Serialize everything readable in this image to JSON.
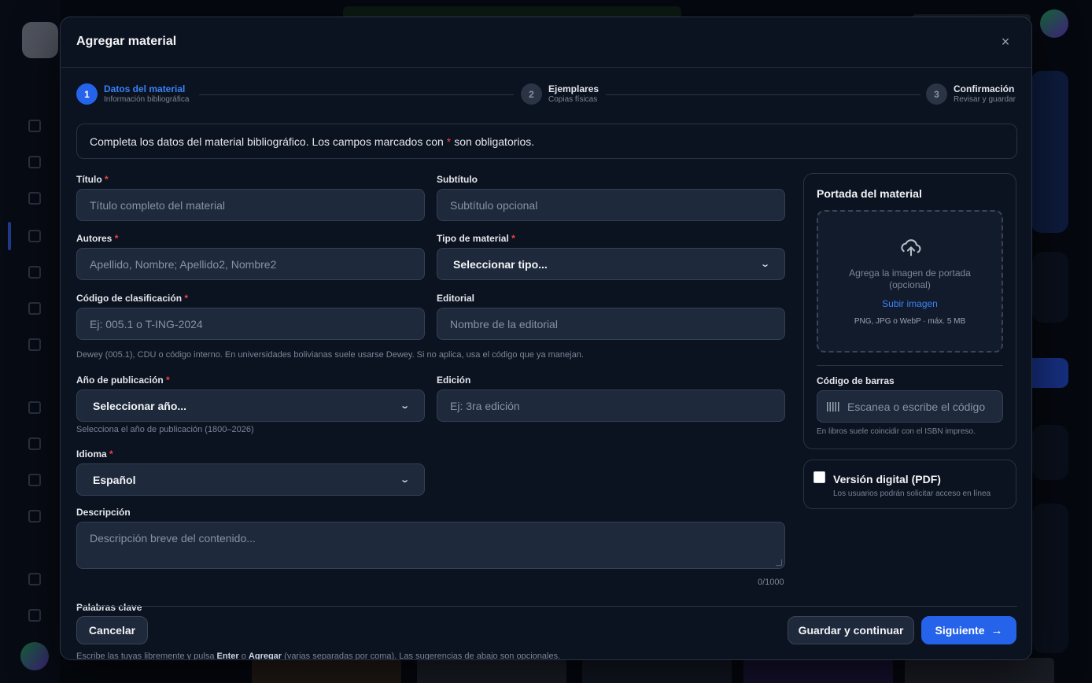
{
  "modal": {
    "title": "Agregar material",
    "close_icon": "×"
  },
  "stepper": {
    "steps": [
      {
        "number": "1",
        "label": "Datos del material",
        "sub": "Información bibliográfica",
        "state": "active"
      },
      {
        "number": "2",
        "label": "Ejemplares",
        "sub": "Copias físicas",
        "state": "idle"
      },
      {
        "number": "3",
        "label": "Confirmación",
        "sub": "Revisar y guardar",
        "state": "idle"
      }
    ]
  },
  "info": {
    "before": "Completa los datos del material bibliográfico. Los campos marcados con",
    "star": "*",
    "after": "son obligatorios."
  },
  "form": {
    "titulo": {
      "label": "Título",
      "required": "*",
      "placeholder": "Título completo del material"
    },
    "subtitulo": {
      "label": "Subtítulo",
      "placeholder": "Subtítulo opcional"
    },
    "autores": {
      "label": "Autores",
      "required": "*",
      "placeholder": "Apellido, Nombre; Apellido2, Nombre2"
    },
    "tipo": {
      "label": "Tipo de material",
      "required": "*",
      "value": "Seleccionar tipo..."
    },
    "codigo": {
      "label": "Código de clasificación",
      "required": "*",
      "placeholder": "Ej: 005.1 o T-ING-2024",
      "hint": "Dewey (005.1), CDU o código interno. En universidades bolivianas suele usarse Dewey. Si no aplica, usa el código que ya manejan."
    },
    "editorial": {
      "label": "Editorial",
      "placeholder": "Nombre de la editorial"
    },
    "anio": {
      "label": "Año de publicación",
      "required": "*",
      "value": "Seleccionar año...",
      "hint": "Selecciona el año de publicación (1800–2026)"
    },
    "edicion": {
      "label": "Edición",
      "placeholder": "Ej: 3ra edición"
    },
    "idioma": {
      "label": "Idioma",
      "required": "*",
      "value": "Español"
    },
    "descripcion": {
      "label": "Descripción",
      "placeholder": "Descripción breve del contenido...",
      "counter": "0/1000"
    },
    "palabras": {
      "label": "Palabras clave",
      "hint_pre": "Escribe las tuyas libremente y pulsa",
      "hint_enter": "Enter",
      "hint_mid": "o",
      "hint_add": "Agregar",
      "hint_post": "(varias separadas por coma). Las sugerencias de abajo son opcionales."
    }
  },
  "cover": {
    "title": "Portada del material",
    "upload_icon": "cloud-upload-icon",
    "drop_text": "Agrega la imagen de portada (opcional)",
    "upload_link": "Subir imagen",
    "formats": "PNG, JPG o WebP · máx. 5 MB",
    "barcode_label": "Código de barras",
    "barcode_icon": "barcode-icon",
    "barcode_placeholder": "Escanea o escribe el código",
    "barcode_hint": "En libros suele coincidir con el ISBN impreso."
  },
  "digital": {
    "checked": false,
    "title": "Versión digital (PDF)",
    "sub": "Los usuarios podrán solicitar acceso en línea"
  },
  "footer": {
    "cancel": "Cancelar",
    "save_continue": "Guardar y continuar",
    "next": "Siguiente",
    "next_icon": "→"
  },
  "colors": {
    "accent": "#2563eb",
    "required": "#ef4444",
    "modal_bg": "#0b1220",
    "input_bg": "#1e293b"
  }
}
